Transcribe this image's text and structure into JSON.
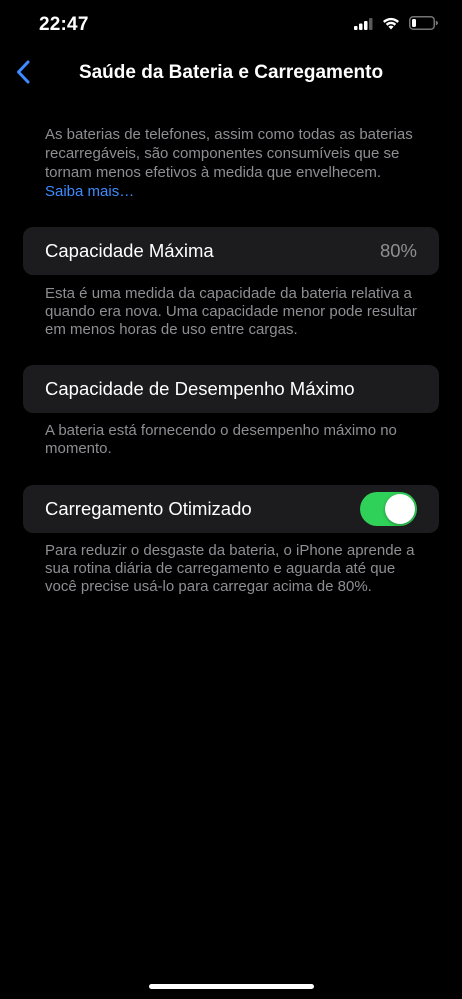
{
  "status_bar": {
    "time": "22:47"
  },
  "icons": {
    "signal": "cellular-signal-icon",
    "wifi": "wifi-icon",
    "battery": "battery-low-icon",
    "back": "chevron-left-icon"
  },
  "nav": {
    "title": "Saúde da Bateria e Carregamento"
  },
  "intro": {
    "text": "As baterias de telefones, assim como todas as baterias recarregáveis, são componentes consumíveis que se tornam menos efetivos à medida que envelhecem.",
    "link": "Saiba mais…"
  },
  "max_capacity": {
    "label": "Capacidade Máxima",
    "value": "80%",
    "footnote": "Esta é uma medida da capacidade da bateria relativa a quando era nova. Uma capacidade menor pode resultar em menos horas de uso entre cargas."
  },
  "peak_performance": {
    "label": "Capacidade de Desempenho Máximo",
    "footnote": "A bateria está fornecendo o desempenho máximo no momento."
  },
  "optimized_charging": {
    "label": "Carregamento Otimizado",
    "enabled": true,
    "footnote": "Para reduzir o desgaste da bateria, o iPhone aprende a sua rotina diária de carregamento e aguarda até que você precise usá-lo para carregar acima de 80%."
  },
  "colors": {
    "background": "#000000",
    "card": "#1c1c1e",
    "secondary_text": "#8e8e93",
    "link": "#3d8bff",
    "toggle_on": "#30d158"
  }
}
